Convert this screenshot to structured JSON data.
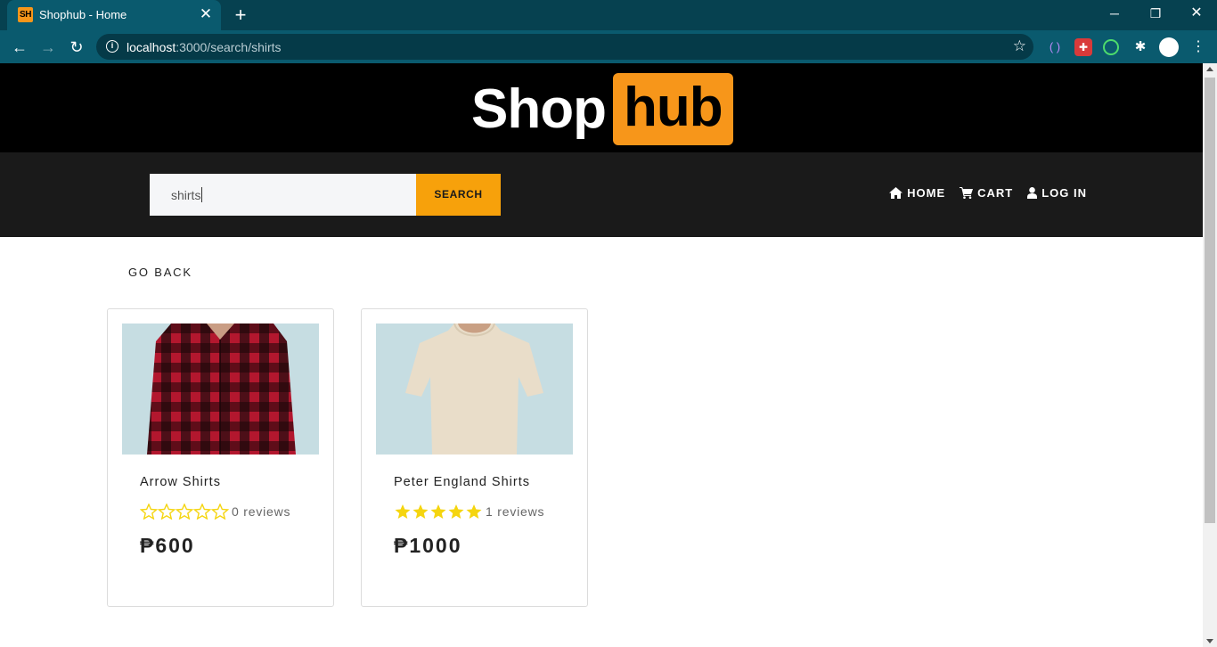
{
  "browser": {
    "tab_title": "Shophub - Home",
    "tab_favicon_text": "SH",
    "url_host": "localhost",
    "url_path": ":3000/search/shirts",
    "window_controls": [
      "minimize-icon",
      "restore-icon",
      "close-icon"
    ],
    "extensions": [
      "cast-icon",
      "gift-icon",
      "target-icon",
      "puzzle-icon",
      "profile-icon",
      "kebab-menu-icon"
    ]
  },
  "site": {
    "logo_left": "Shop",
    "logo_right": "hub",
    "brand_color": "#f7961a",
    "accent_color": "#f7a10b"
  },
  "search": {
    "value": "shirts",
    "button_label": "SEARCH"
  },
  "nav": {
    "home": "HOME",
    "cart": "CART",
    "login": "LOG IN"
  },
  "go_back": "GO BACK",
  "products": [
    {
      "name": "Arrow Shirts",
      "rating": 0,
      "reviews": "0 reviews",
      "price": "₱600",
      "image": "red-black-flannel-shirt"
    },
    {
      "name": "Peter England Shirts",
      "rating": 5,
      "reviews": "1 reviews",
      "price": "₱1000",
      "image": "beige-tshirt"
    }
  ],
  "star_color": "#f5d50f"
}
